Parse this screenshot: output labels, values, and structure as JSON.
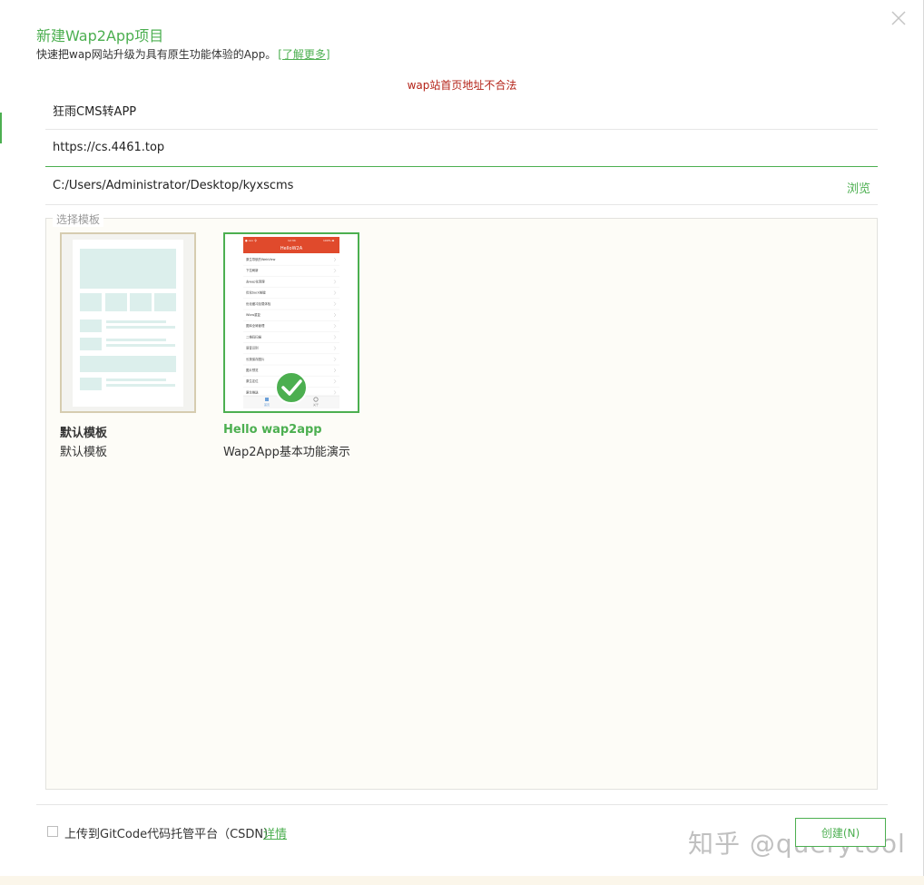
{
  "header": {
    "title": "新建Wap2App项目",
    "subtitle": "快速把wap网站升级为具有原生功能体验的App。",
    "learn_more": "[了解更多]"
  },
  "error": "wap站首页地址不合法",
  "form": {
    "app_name": "狂雨CMS转APP",
    "url": "https://cs.4461.top",
    "path": "C:/Users/Administrator/Desktop/kyxscms",
    "browse_label": "浏览"
  },
  "templates": {
    "legend": "选择模板",
    "items": [
      {
        "name": "默认模板",
        "desc": "默认模板",
        "selected": false
      },
      {
        "name": "Hello wap2app",
        "desc": "Wap2App基本功能演示",
        "selected": true
      }
    ],
    "preview": {
      "status_left": "● ooo 令",
      "status_mid": "12:34",
      "status_right": "100% ▬",
      "header": "HelloW2A",
      "rows": [
        "原生导航的WebView",
        "下拉刷新",
        "去wap化清理",
        "优化back按键",
        "优化缓冲加载体验",
        "Wlow重复",
        "图库全局管理",
        "二维码扫描",
        "语音识别",
        "长按保存图片",
        "图片预览",
        "原生定位",
        "原生推送"
      ],
      "tabs": [
        "首页",
        "关于"
      ]
    }
  },
  "footer": {
    "checkbox_label": "上传到GitCode代码托管平台（CSDN）",
    "detail_link": "详情",
    "create_label": "创建(N)",
    "watermark": "知乎 @querytool"
  },
  "colors": {
    "accent": "#4caf50",
    "error": "#b42318",
    "preview_header": "#e04a2c"
  }
}
